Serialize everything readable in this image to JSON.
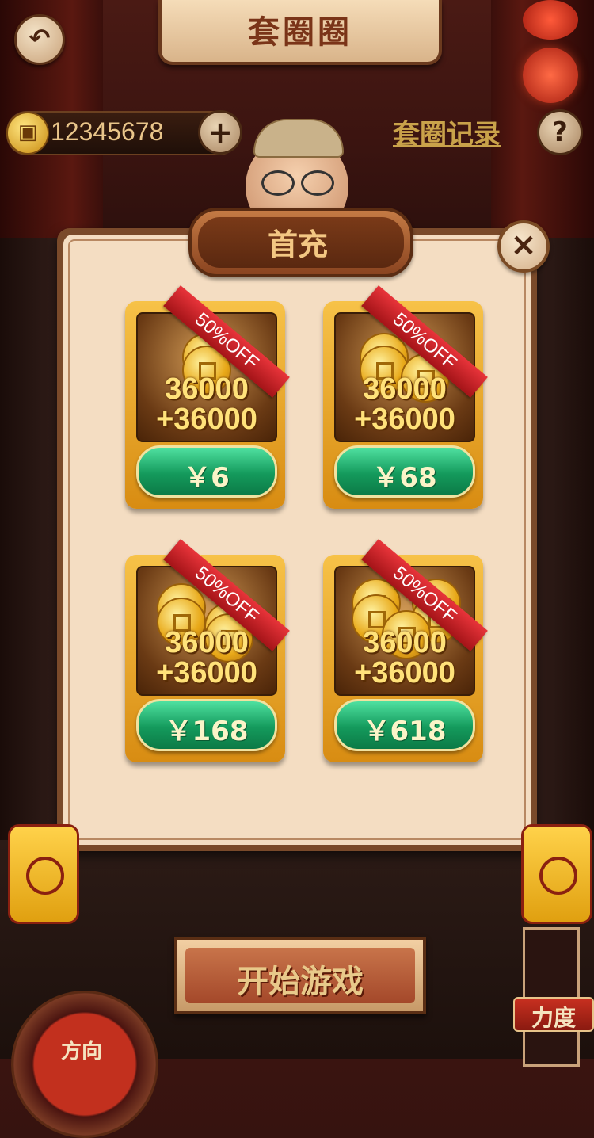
{
  "header": {
    "title": "套圈圈"
  },
  "wallet": {
    "coins": "12345678"
  },
  "links": {
    "record": "套圈记录",
    "help": "?"
  },
  "modal": {
    "title": "首充",
    "close": "×",
    "packages": [
      {
        "amount_line1": "36000",
        "amount_line2": "+36000",
        "discount": "50%OFF",
        "price": "￥6"
      },
      {
        "amount_line1": "36000",
        "amount_line2": "+36000",
        "discount": "50%OFF",
        "price": "￥68"
      },
      {
        "amount_line1": "36000",
        "amount_line2": "+36000",
        "discount": "50%OFF",
        "price": "￥168"
      },
      {
        "amount_line1": "36000",
        "amount_line2": "+36000",
        "discount": "50%OFF",
        "price": "￥618"
      }
    ]
  },
  "controls": {
    "start": "开始游戏",
    "direction": "方向",
    "power": "力度"
  },
  "icons": {
    "back": "back-arrow-icon",
    "coin": "coin-icon",
    "plus": "plus-icon",
    "help": "question-icon",
    "close": "close-icon"
  },
  "colors": {
    "price_button": "#149a5c",
    "ribbon": "#d0242a",
    "card_gold": "#e8a020",
    "modal_bg": "#f4ddc2"
  }
}
